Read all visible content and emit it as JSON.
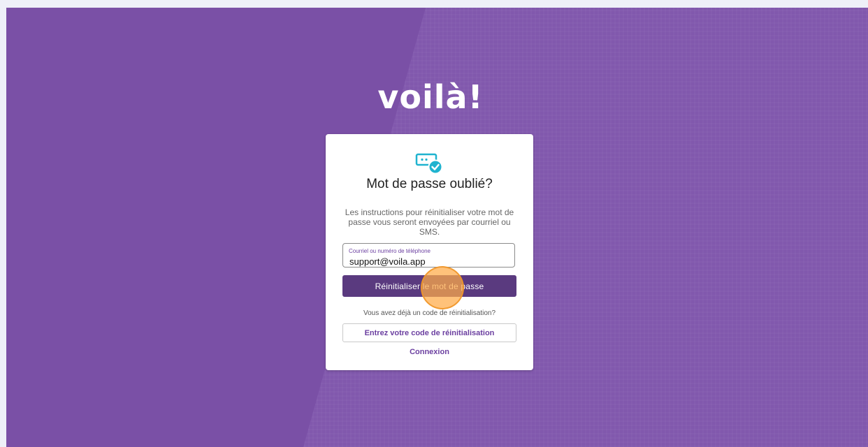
{
  "brand": {
    "logo_text": "voilà!"
  },
  "reset_card": {
    "icon": "password-check-icon",
    "title": "Mot de passe oublié?",
    "description": "Les instructions pour réinitialiser votre mot de passe vous seront envoyées par courriel ou SMS.",
    "field_label": "Courriel ou numéro de téléphone",
    "field_value": "support@voila.app",
    "submit_label": "Réinitialiser le mot de passe",
    "question": "Vous avez déjà un code de réinitialisation?",
    "code_button_label": "Entrez votre code de réinitialisation",
    "login_link": "Connexion"
  },
  "colors": {
    "background": "#7a50a6",
    "primary_button": "#5a3a7f",
    "accent": "#6b3fa0",
    "icon_teal": "#1fb3cf"
  }
}
